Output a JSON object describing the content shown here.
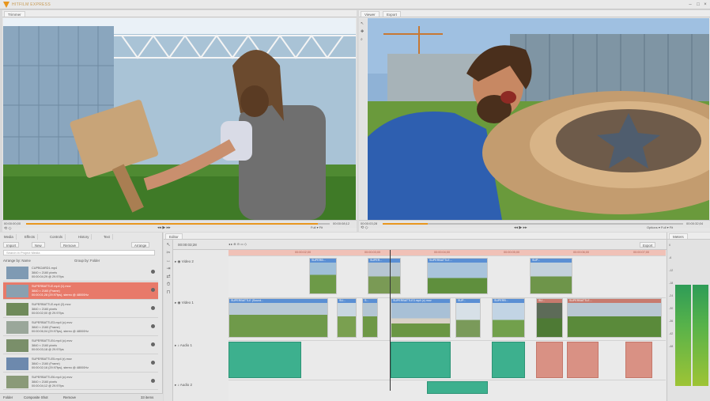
{
  "app": {
    "name": "HITFILM EXPRESS"
  },
  "viewer_left": {
    "tab": "Trimmer",
    "timecode_left": "00:00:00;00",
    "timecode_right": "00:00:08;12",
    "zoom": "Full",
    "fit": "Fit",
    "progress": 0.96
  },
  "viewer_right": {
    "tabs": [
      "Viewer",
      "Export"
    ],
    "timecode_left": "00:00:03;28",
    "timecode_right": "00:00:32;04",
    "options": "Options",
    "zoom": "Full",
    "fit": "Fit",
    "progress": 0.15
  },
  "media_panel": {
    "tabs": [
      "Media",
      "Effects",
      "Controls",
      "History",
      "Text"
    ],
    "toolbar": {
      "import": "Import",
      "new": "New",
      "remove": "Remove",
      "arrange": "Arrange"
    },
    "search_placeholder": "Search in Project Media",
    "arrange_label": "Arrange by: Name",
    "group_label": "Group by: Folder",
    "items": [
      {
        "name": "CUPBOARD1.mp4",
        "line1": "3840 × 2160 pixels",
        "line2": "00:00:04;29 @ 29.97fps"
      },
      {
        "name": "SUPERBATTLE.mp4 (1).mov",
        "line1": "3840 × 2160 (Frame)",
        "line2": "00:00:01;28 (29.97fps), stereo @ 48000Hz"
      },
      {
        "name": "SUPERBATTLE.mp4 (2).mov",
        "line1": "3840 × 2160 pixels",
        "line2": "00:00:02;00 @ 29.97fps"
      },
      {
        "name": "SUPERBATTLE3.mp4 (c).mov",
        "line1": "3840 × 2160 (Frame)",
        "line2": "00:00:06;04 (29.97fps), stereo @ 48000Hz"
      },
      {
        "name": "SUPERBATTLE4.mp4 (c).mov",
        "line1": "3840 × 2160 pixels",
        "line2": "00:00:03;18 @ 29.97fps"
      },
      {
        "name": "SUPERBATTLE5.mp4 (r).mov",
        "line1": "3840 × 2160 (Frame)",
        "line2": "00:00:02;16 (29.97fps), stereo @ 48000Hz"
      },
      {
        "name": "SUPERBATTLE6.mp4 (c).mov",
        "line1": "3840 × 2160 pixels",
        "line2": "00:00:04;12 @ 29.97fps"
      },
      {
        "name": "SUPERBATTLE7.mp4 (c).mov",
        "line1": "3840 × 2160 (Frame)",
        "line2": "00:00:05;10 (29.97fps), stereo @ 48000Hz"
      }
    ],
    "footer": {
      "folder": "Folder",
      "composite": "Composite Shot",
      "remove": "Remove",
      "count": "33 items"
    }
  },
  "timeline": {
    "tab": "Editor",
    "timecode": "00:00:03;28",
    "export_label": "Export",
    "ruler_labels": [
      "00:00:02;00",
      "00:00:03;00",
      "00:00:04;00",
      "00:00:05;00",
      "00:00:06;00",
      "00:00:07;00"
    ],
    "tracks": [
      {
        "name": "Video 2"
      },
      {
        "name": "Video 1"
      },
      {
        "name": "Audio 1"
      },
      {
        "name": "Audio 2"
      }
    ],
    "video2_clips": [
      "SUPERB...",
      "SUPER...",
      "SUPERBATTLE...",
      "SUP..."
    ],
    "video1_clips": [
      "SUPERBATTLE (Sound...",
      "SU...",
      "S...",
      "SUPERBATTLE3.mp4 (c) mov",
      "SUP...",
      "SUPERB...",
      "SU...",
      "SUPERBATTLE..."
    ]
  },
  "meters": {
    "title": "Meters",
    "scale": [
      "0",
      "-6",
      "-12",
      "-18",
      "-24",
      "-30",
      "-36",
      "-42",
      "-48"
    ]
  },
  "colors": {
    "accent": "#e8961e",
    "selection": "#e87a6a",
    "video_clip": "#5a8fd4",
    "audio_clip": "#3db08e",
    "ruler": "#f0c1b7"
  }
}
